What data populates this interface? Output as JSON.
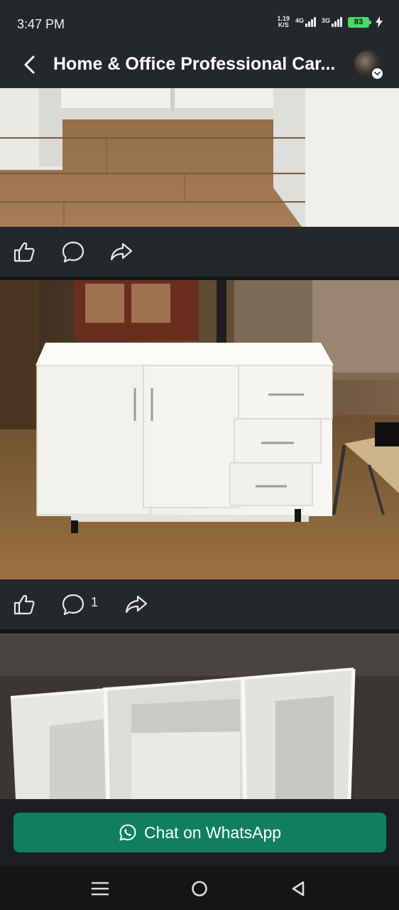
{
  "status_bar": {
    "time": "3:47 PM",
    "speed_value": "1.19",
    "speed_unit": "K/S",
    "net1": "4G",
    "net2": "3G",
    "battery": "83"
  },
  "header": {
    "title": "Home & Office Professional Car..."
  },
  "posts": [
    {
      "comment_count": ""
    },
    {
      "comment_count": "1"
    }
  ],
  "whatsapp": {
    "label": "Chat on WhatsApp",
    "color": "#0f7f5f"
  },
  "icons": {
    "back": "chevron-left-icon",
    "like": "thumbs-up-icon",
    "comment": "comment-icon",
    "share": "share-icon",
    "whatsapp": "whatsapp-icon",
    "menu": "menu-icon",
    "home": "home-icon",
    "back_nav": "triangle-back-icon"
  }
}
